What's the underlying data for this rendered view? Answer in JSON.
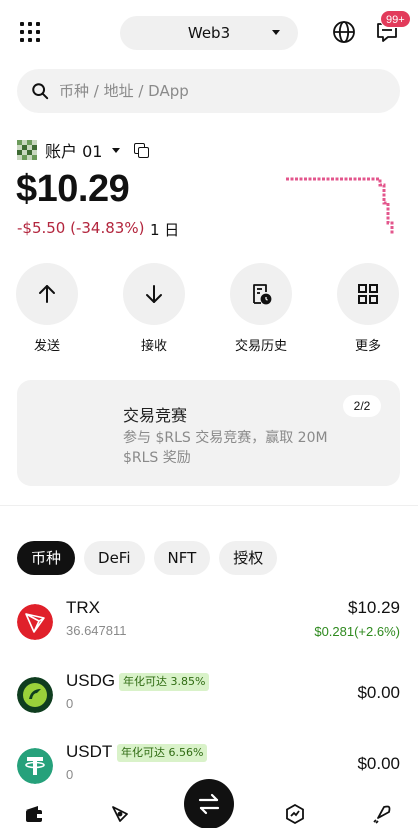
{
  "header": {
    "network_label": "Web3",
    "notification_count": "99+"
  },
  "search": {
    "placeholder": "币种 / 地址 / DApp"
  },
  "account": {
    "name": "账户 01",
    "balance": "$10.29",
    "change": "-$5.50 (-34.83%)",
    "period": "1 日"
  },
  "actions": [
    {
      "label": "发送",
      "icon": "arrow-up-icon"
    },
    {
      "label": "接收",
      "icon": "arrow-down-icon"
    },
    {
      "label": "交易历史",
      "icon": "history-icon"
    },
    {
      "label": "更多",
      "icon": "grid-icon"
    }
  ],
  "banner": {
    "title": "交易竞赛",
    "description": "参与 $RLS 交易竞赛，赢取 20M $RLS 奖励",
    "pager": "2/2"
  },
  "tabs": [
    {
      "label": "币种",
      "active": true
    },
    {
      "label": "DeFi",
      "active": false
    },
    {
      "label": "NFT",
      "active": false
    },
    {
      "label": "授权",
      "active": false
    }
  ],
  "tokens": [
    {
      "symbol": "TRX",
      "amount": "36.647811",
      "value": "$10.29",
      "change": "$0.281(+2.6%)",
      "apy": "",
      "icon": "trx-icon",
      "color": "#e0202a"
    },
    {
      "symbol": "USDG",
      "amount": "0",
      "value": "$0.00",
      "change": "",
      "apy": "年化可达 3.85%",
      "icon": "usdg-icon",
      "color": "#0f3d1f"
    },
    {
      "symbol": "USDT",
      "amount": "0",
      "value": "$0.00",
      "change": "",
      "apy": "年化可达 6.56%",
      "icon": "usdt-icon",
      "color": "#26a17b"
    }
  ],
  "colors": {
    "negative": "#b3263e",
    "positive": "#2f8a1f",
    "sparkline": "#e3568c",
    "badge": "#e23b5b"
  },
  "bottom_nav": [
    "wallet-icon",
    "discover-icon",
    "swap-icon",
    "earn-icon",
    "rocket-icon"
  ]
}
